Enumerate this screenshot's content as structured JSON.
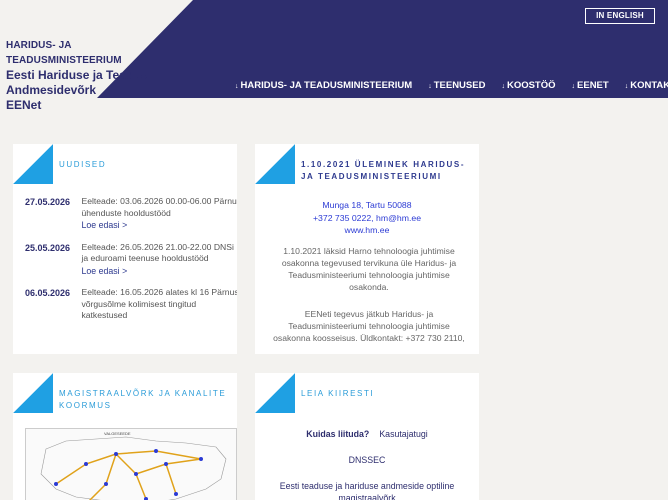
{
  "header": {
    "logo_line1": "HARIDUS- JA TEADUSMINISTEERIUM",
    "logo_line2": "Eesti Hariduse ja Teadus",
    "logo_line3": "Andmesidevõrk",
    "logo_line4": "EENet",
    "lang_button": "IN ENGLISH",
    "nav": [
      {
        "label": "HARIDUS- JA TEADUSMINISTEERIUM"
      },
      {
        "label": "TEENUSED"
      },
      {
        "label": "KOOSTÖÖ"
      },
      {
        "label": "EENET"
      },
      {
        "label": "KONTAKT"
      }
    ],
    "nav_arrow": "↓",
    "colors": {
      "dark": "#2e2e6e",
      "light": "#f3f2ef"
    }
  },
  "news": {
    "title": "UUDISED",
    "items": [
      {
        "date": "27.05.2026",
        "text": "Eelteade: 03.06.2026 00.00-06.00 Pärnu ühenduste hooldustööd",
        "link": "Loe edasi >"
      },
      {
        "date": "25.05.2026",
        "text": "Eelteade: 26.05.2026 21.00-22.00 DNSi ja eduroami teenuse hooldustööd",
        "link": "Loe edasi >"
      },
      {
        "date": "06.05.2026",
        "text": "Eelteade: 16.05.2026 alates kl 16 Pärnus võrgusõlme kolimisest tingitud katkestused",
        "link": ""
      }
    ]
  },
  "info": {
    "title_line1": "1.10.2021 ÜLEMINEK HARIDUS-",
    "title_line2": "JA TEADUSMINISTEERIUMI",
    "address": "Munga 18, Tartu 50088",
    "phone_email": "+372 735 0222, hm@hm.ee",
    "web": "www.hm.ee",
    "para1": "1.10.2021 läksid Harno tehnoloogia juhtimise osakonna tegevused tervikuna üle Haridus- ja Teadusministeeriumi tehnoloogia juhtimise osakonda.",
    "para2": "EENeti tegevus jätkub Haridus- ja Teadusministeeriumi tehnoloogia juhtimise osakonna koosseisus. Üldkontakt: +372 730 2110,"
  },
  "map_card": {
    "title_line1": "MAGISTRAALVÕRK JA KANALITE",
    "title_line2": "KOORMUS",
    "map_label": "VALGESEEDE"
  },
  "quick": {
    "title": "LEIA KIIRESTI",
    "howto": "Kuidas liituda?",
    "guide": "Kasutajatugi",
    "dnssec": "DNSSEC",
    "backbone_line1": "Eesti teaduse ja hariduse andmeside optiline",
    "backbone_line2": "magistraalvõrk"
  },
  "accent_colors": {
    "corner_blue": "#1fa0e3",
    "nav_dark": "#2e2e6e"
  }
}
